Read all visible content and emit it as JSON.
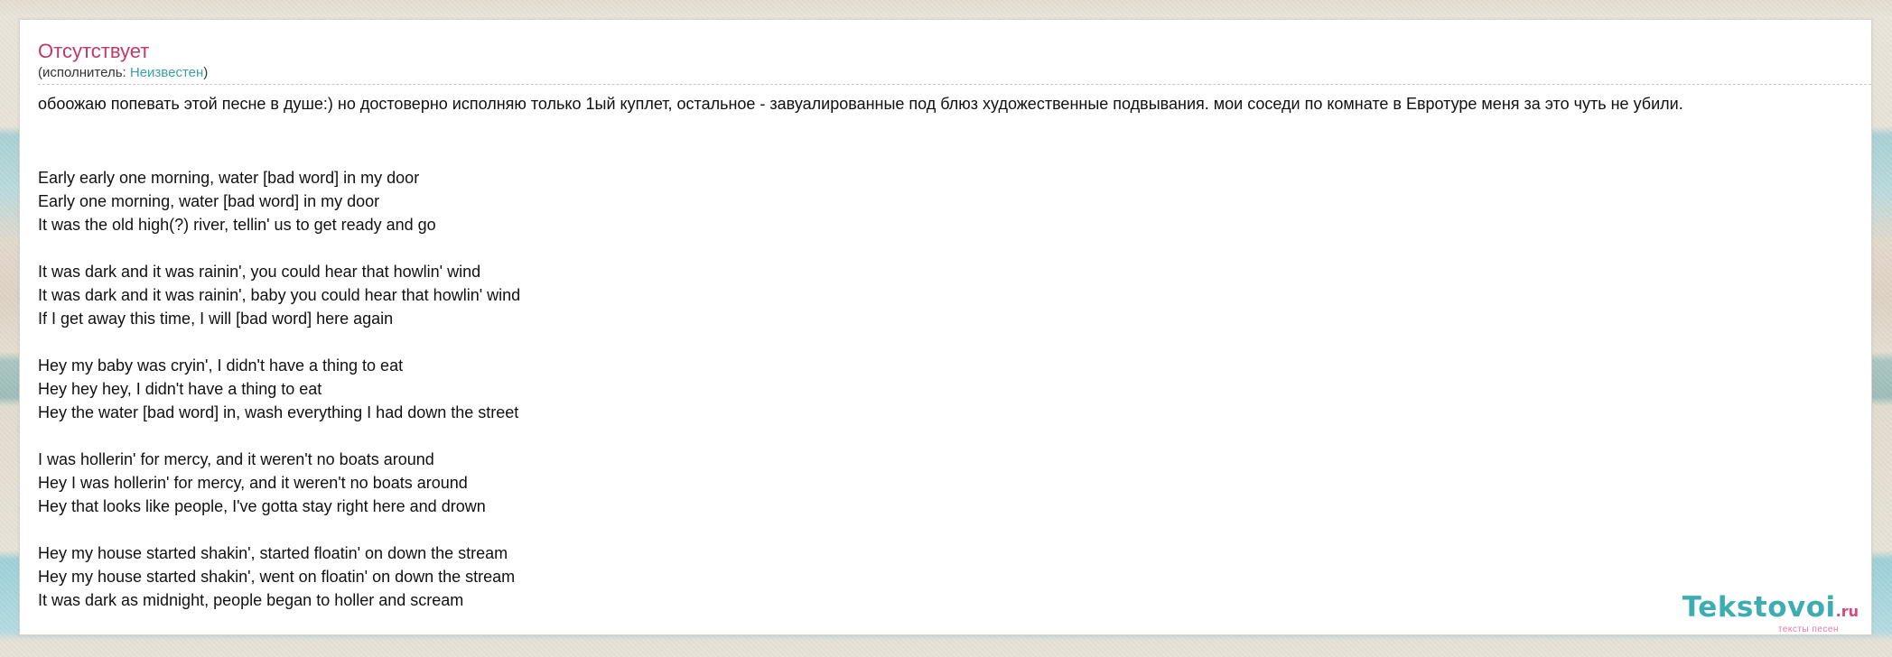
{
  "song": {
    "title": "Отсутствует",
    "artist_prefix": "(исполнитель: ",
    "artist_name": "Неизвестен",
    "artist_suffix": ")",
    "comment": "обоожаю попевать этой песне в душе:) но достоверно исполняю только 1ый куплет, остальное - завуалированные под блюз художественные подвывания. мои соседи по комнате в Евротуре меня за это чуть не убили."
  },
  "lyrics": [
    {
      "lines": [
        "Early early one morning, water [bad word]  in my door",
        "Early one morning, water [bad word]  in my door",
        "It was the old high(?) river, tellin' us to get ready and go"
      ]
    },
    {
      "lines": [
        "It was dark and it was rainin', you could hear that howlin' wind",
        "It was dark and it was rainin', baby you could hear that howlin' wind",
        "If I get away this time, I will [bad word] here again"
      ]
    },
    {
      "lines": [
        "Hey my baby was cryin', I didn't have a thing to eat",
        "Hey hey hey, I didn't have a thing to eat",
        "Hey the water [bad word] in, wash everything I had down the street"
      ]
    },
    {
      "lines": [
        "I was hollerin' for mercy, and it weren't no boats around",
        "Hey I was hollerin' for mercy, and it weren't no boats around",
        "Hey that looks like people, I've gotta stay right here and drown"
      ]
    },
    {
      "lines": [
        "Hey my house started shakin', started floatin' on down the stream",
        "Hey my house started shakin', went on floatin' on down the stream",
        "It was dark as midnight, people began to holler and scream"
      ]
    }
  ],
  "logo": {
    "name": "Tekstovoi",
    "tld": ".ru",
    "tagline": "тексты песен"
  }
}
